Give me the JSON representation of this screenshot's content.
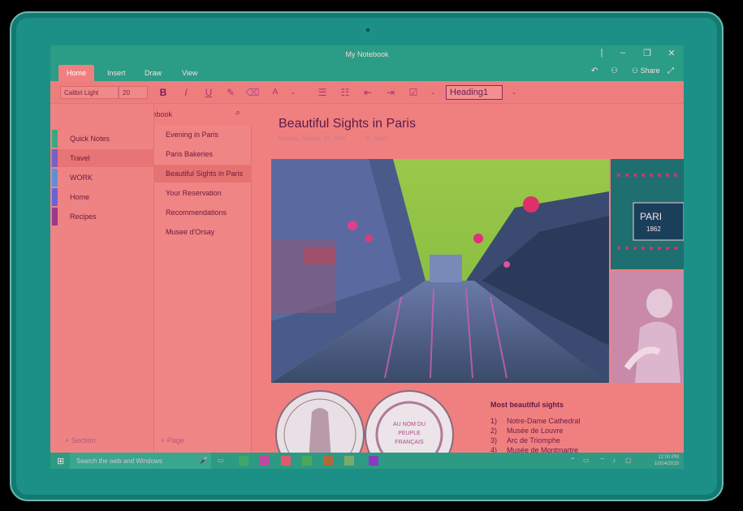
{
  "window": {
    "title": "My Notebook",
    "controls": [
      "minimize",
      "restore",
      "close"
    ]
  },
  "ribbon": {
    "tabs": [
      {
        "label": "Home",
        "active": true
      },
      {
        "label": "Insert",
        "active": false
      },
      {
        "label": "Draw",
        "active": false
      },
      {
        "label": "View",
        "active": false
      }
    ],
    "share_label": "Share"
  },
  "toolbar": {
    "font_name": "Calibri Light",
    "font_size": "20",
    "style": "Heading1",
    "icons": [
      "bold-icon",
      "italic-icon",
      "underline-icon",
      "highlight-icon",
      "eraser-icon",
      "font-color-icon",
      "bullets-icon",
      "numbering-icon",
      "outdent-icon",
      "indent-icon",
      "checkbox-icon"
    ]
  },
  "sidebar": {
    "notebook_name": "My Notebook",
    "sections": [
      {
        "label": "Quick Notes",
        "color": "#3aa87f"
      },
      {
        "label": "Travel",
        "color": "#7a5fc4",
        "active": true
      },
      {
        "label": "WORK",
        "color": "#5f8fd6"
      },
      {
        "label": "Home",
        "color": "#6a62d8"
      },
      {
        "label": "Recipes",
        "color": "#9a3a8a"
      }
    ],
    "add_section": "+ Section"
  },
  "pages": {
    "items": [
      {
        "label": "Evening in Paris"
      },
      {
        "label": "Paris Bakeries"
      },
      {
        "label": "Beautiful Sights in Paris",
        "active": true
      },
      {
        "label": "Your Reservation"
      },
      {
        "label": "Recommendations"
      },
      {
        "label": "Musee d'Orsay"
      }
    ],
    "add_page": "+ Page"
  },
  "content": {
    "title": "Beautiful Sights in Paris",
    "date": "Monday, January 15, 2016",
    "time": "11:30am",
    "sights_title": "Most beautiful sights",
    "sights": [
      {
        "num": "1)",
        "label": "Notre-Dame Cathedral"
      },
      {
        "num": "2)",
        "label": "Musée de Louvre"
      },
      {
        "num": "3)",
        "label": "Arc de Triomphe"
      },
      {
        "num": "4)",
        "label": "Musée de Montmartre"
      }
    ],
    "photo_side_text": "PARI",
    "photo_side_year": "1862",
    "coin_text": "AU NOM DU PEUPLE FRANÇAIS"
  },
  "taskbar": {
    "search_placeholder": "Search the web and Windows",
    "time": "12:00 PM",
    "date": "10/24/2015"
  }
}
